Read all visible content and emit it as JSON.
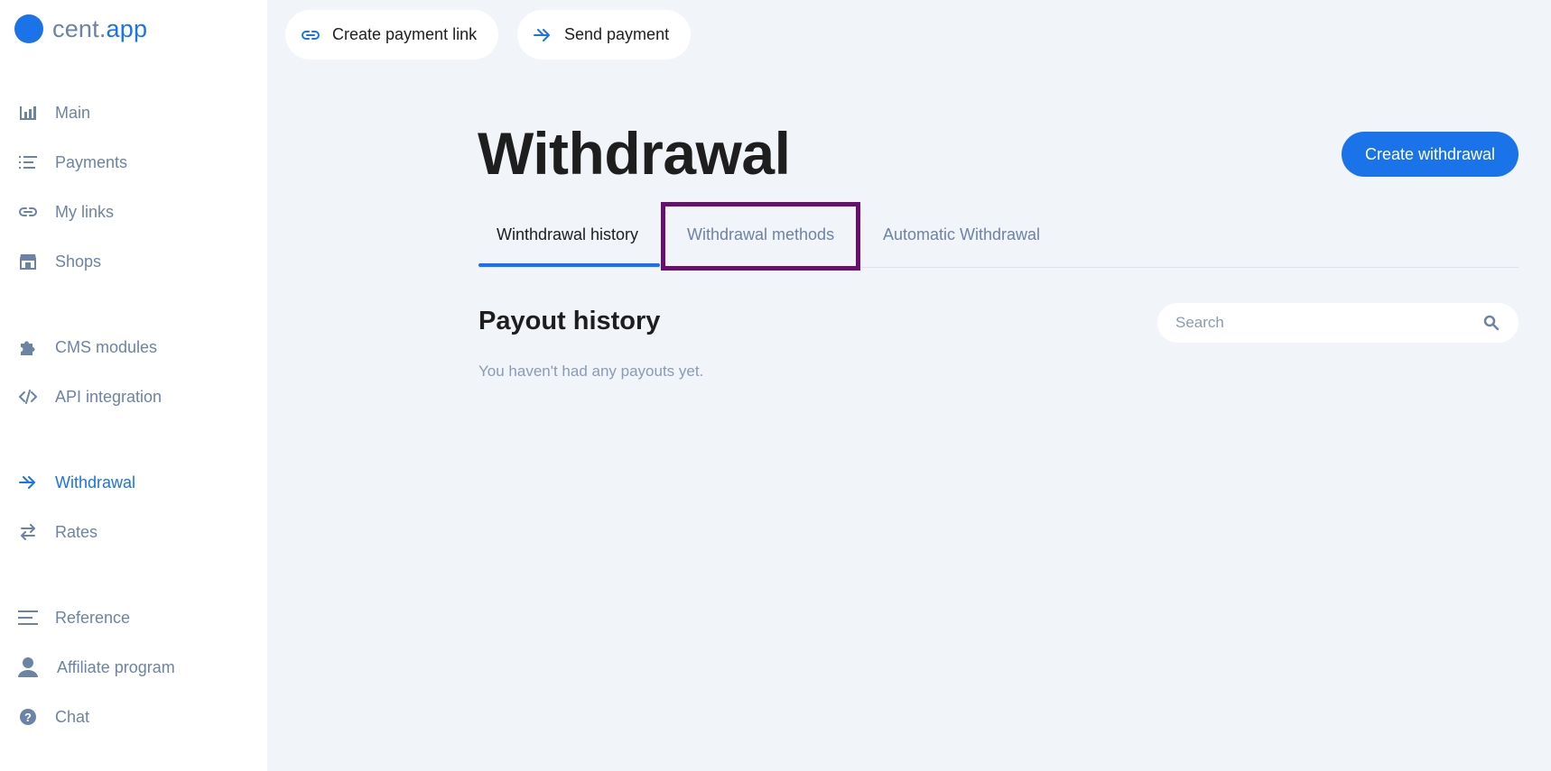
{
  "brand": {
    "name_part1": "cent.",
    "name_part2": "app"
  },
  "top_actions": {
    "create_link_label": "Create payment link",
    "send_payment_label": "Send payment"
  },
  "sidebar": {
    "items": [
      {
        "label": "Main",
        "icon": "bar-chart-icon"
      },
      {
        "label": "Payments",
        "icon": "list-icon"
      },
      {
        "label": "My links",
        "icon": "link-icon"
      },
      {
        "label": "Shops",
        "icon": "shop-icon"
      },
      {
        "label": "CMS modules",
        "icon": "puzzle-icon"
      },
      {
        "label": "API integration",
        "icon": "code-icon"
      },
      {
        "label": "Withdrawal",
        "icon": "double-arrow-icon",
        "active": true
      },
      {
        "label": "Rates",
        "icon": "exchange-icon"
      },
      {
        "label": "Reference",
        "icon": "menu-icon"
      },
      {
        "label": "Affiliate program",
        "icon": "user-icon"
      },
      {
        "label": "Chat",
        "icon": "help-icon"
      }
    ]
  },
  "main": {
    "title": "Withdrawal",
    "create_button_label": "Create withdrawal",
    "tabs": [
      {
        "label": "Winthdrawal history",
        "active": true
      },
      {
        "label": "Withdrawal methods"
      },
      {
        "label": "Automatic Withdrawal"
      }
    ],
    "section_title": "Payout history",
    "empty_message": "You haven't had any payouts yet.",
    "search": {
      "placeholder": "Search",
      "value": ""
    }
  },
  "colors": {
    "accent": "#1a73e8",
    "sidebar_text": "#6d83a6",
    "background": "#f1f4f8",
    "highlight": "#6a0f6f"
  }
}
